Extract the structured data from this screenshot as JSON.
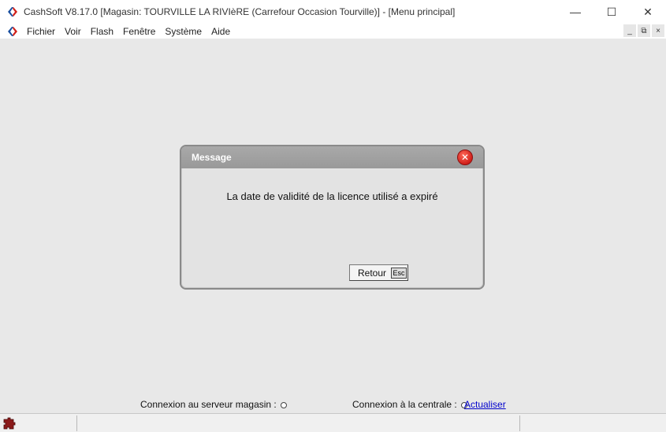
{
  "window": {
    "title": "CashSoft V8.17.0 [Magasin: TOURVILLE LA RIVIèRE (Carrefour Occasion Tourville)] - [Menu principal]",
    "controls": {
      "minimize": "—",
      "maximize": "☐",
      "close": "✕"
    }
  },
  "menu": {
    "items": [
      "Fichier",
      "Voir",
      "Flash",
      "Fenêtre",
      "Système",
      "Aide"
    ],
    "mdi": {
      "minimize": "_",
      "restore": "⧉",
      "close": "×"
    }
  },
  "dialog": {
    "title": "Message",
    "close_symbol": "✕",
    "message": "La date de validité de la licence utilisé a expiré",
    "retour_label": "Retour",
    "esc_label": "Esc"
  },
  "status": {
    "server_label": "Connexion au serveur magasin :",
    "central_label": "Connexion à la centrale :",
    "refresh_link": "Actualiser"
  },
  "colors": {
    "brand_blue": "#1a4fa0",
    "brand_red": "#d0201a",
    "dialog_header": "#a0a0a0",
    "workspace": "#e8e8e8"
  }
}
